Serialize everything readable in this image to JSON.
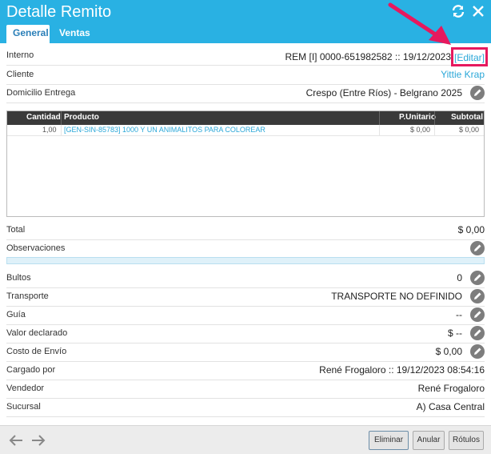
{
  "window": {
    "title": "Detalle Remito"
  },
  "tabs": [
    {
      "label": "General"
    },
    {
      "label": "Ventas"
    }
  ],
  "fields": {
    "interno": {
      "label": "Interno",
      "value": "REM [I] 0000-651982582 :: 19/12/2023",
      "edit_link": "[Editar]"
    },
    "cliente": {
      "label": "Cliente",
      "value": "Yittie Krap"
    },
    "domicilio": {
      "label": "Domicilio Entrega",
      "value": "Crespo (Entre Ríos) - Belgrano 2025"
    },
    "total": {
      "label": "Total",
      "value": "$ 0,00"
    },
    "observaciones": {
      "label": "Observaciones"
    },
    "bultos": {
      "label": "Bultos",
      "value": "0"
    },
    "transporte": {
      "label": "Transporte",
      "value": "TRANSPORTE NO DEFINIDO"
    },
    "guia": {
      "label": "Guía",
      "value": "--"
    },
    "valor_declarado": {
      "label": "Valor declarado",
      "value": "$ --"
    },
    "costo_envio": {
      "label": "Costo de Envío",
      "value": "$ 0,00"
    },
    "cargado_por": {
      "label": "Cargado por",
      "value": "René Frogaloro :: 19/12/2023 08:54:16"
    },
    "vendedor": {
      "label": "Vendedor",
      "value": "René Frogaloro"
    },
    "sucursal": {
      "label": "Sucursal",
      "value": "A) Casa Central"
    }
  },
  "table": {
    "columns": [
      "Cantidad",
      "Producto",
      "P.Unitario",
      "Subtotal"
    ],
    "rows": [
      {
        "cantidad": "1,00",
        "producto": "[GEN-SIN-85783] 1000 Y UN ANIMALITOS PARA COLOREAR",
        "punitario": "$ 0,00",
        "subtotal": "$ 0,00"
      }
    ]
  },
  "footer": {
    "buttons": {
      "eliminar": "Eliminar",
      "anular": "Anular",
      "rotulos": "Rótulos"
    }
  },
  "icons": [
    "refresh-icon",
    "close-icon",
    "pencil-icon",
    "arrow-left-icon",
    "arrow-right-icon"
  ],
  "colors": {
    "header": "#29b1e3",
    "link": "#2aa7d8",
    "highlight": "#e6195e"
  }
}
